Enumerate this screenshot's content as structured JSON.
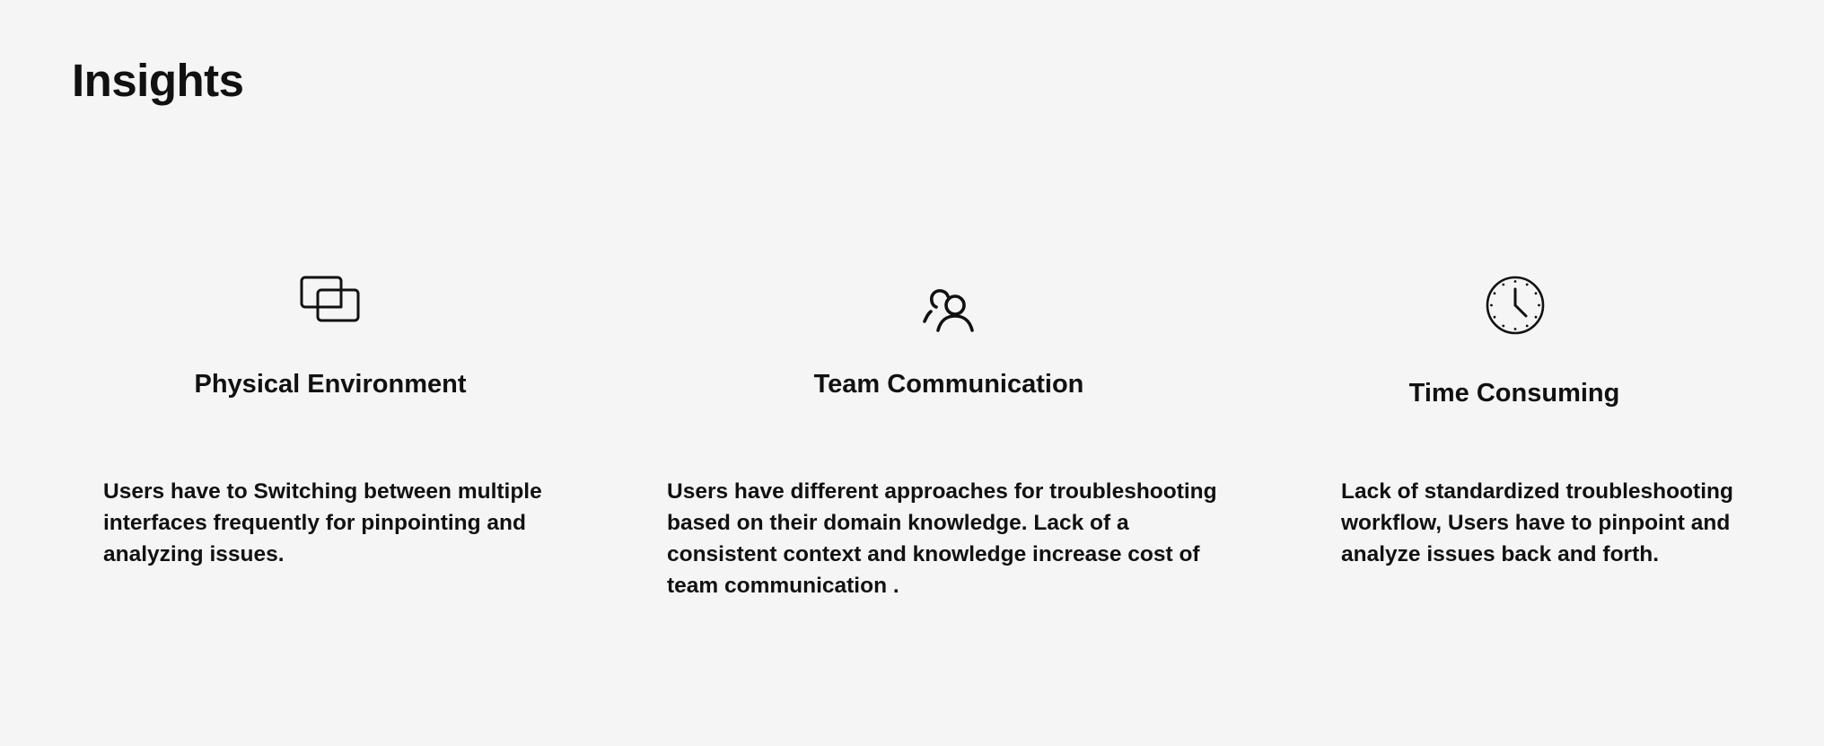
{
  "page": {
    "title": "Insights"
  },
  "cards": [
    {
      "icon": "overlapping-windows-icon",
      "title": "Physical Environment",
      "description": "Users have to Switching between multiple interfaces frequently for pinpointing and analyzing issues."
    },
    {
      "icon": "users-icon",
      "title": "Team Communication",
      "description": "Users have different approaches for troubleshooting based on their domain knowledge.  Lack of a consistent context and knowledge increase cost of team communication ."
    },
    {
      "icon": "clock-icon",
      "title": "Time Consuming",
      "description": "Lack of standardized troubleshooting workflow,  Users have to pinpoint and analyze issues back and forth."
    }
  ],
  "colors": {
    "background": "#f5f5f5",
    "text": "#111111"
  }
}
